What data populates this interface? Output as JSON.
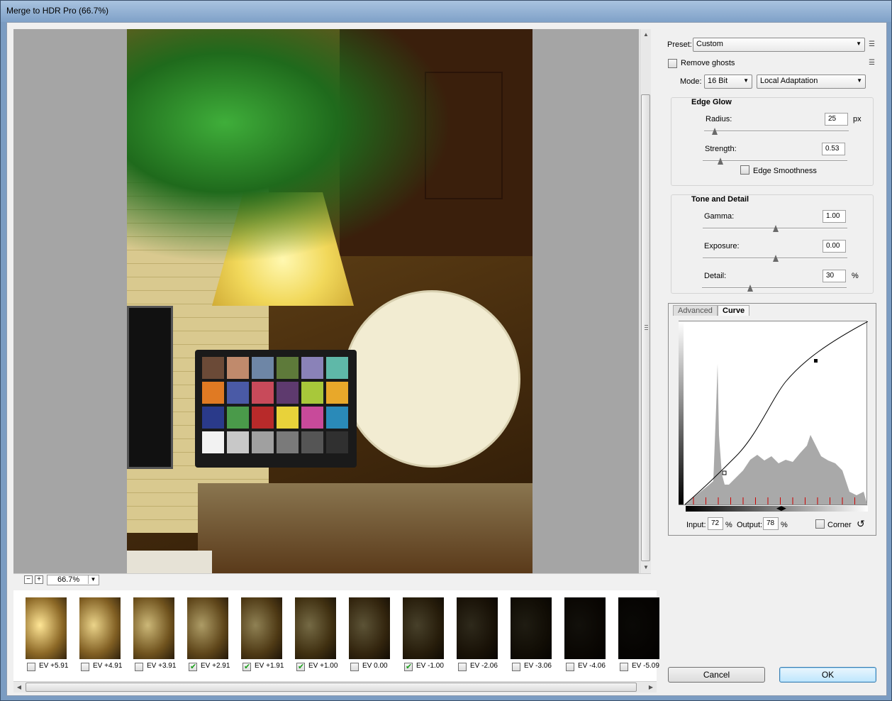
{
  "window": {
    "title": "Merge to HDR Pro (66.7%)"
  },
  "zoom": {
    "value": "66.7%",
    "minus": "−",
    "plus": "+"
  },
  "preset": {
    "label": "Preset:",
    "value": "Custom"
  },
  "remove_ghosts": {
    "label": "Remove ghosts",
    "checked": false
  },
  "mode": {
    "label": "Mode:",
    "bit_depth": "16 Bit",
    "method": "Local Adaptation"
  },
  "edge_glow": {
    "title": "Edge Glow",
    "radius": {
      "label": "Radius:",
      "value": "25",
      "unit": "px",
      "fraction": 0.07
    },
    "strength": {
      "label": "Strength:",
      "value": "0.53",
      "fraction": 0.12
    },
    "edge_smoothness": {
      "label": "Edge Smoothness",
      "checked": false
    }
  },
  "tone_detail": {
    "title": "Tone and Detail",
    "gamma": {
      "label": "Gamma:",
      "value": "1.00",
      "fraction": 0.5
    },
    "exposure": {
      "label": "Exposure:",
      "value": "0.00",
      "fraction": 0.5
    },
    "detail": {
      "label": "Detail:",
      "value": "30",
      "unit": "%",
      "fraction": 0.33
    }
  },
  "tabs": {
    "advanced": "Advanced",
    "curve": "Curve"
  },
  "curve": {
    "input_label": "Input:",
    "input_value": "72",
    "input_unit": "%",
    "output_label": "Output:",
    "output_value": "78",
    "output_unit": "%",
    "corner_label": "Corner",
    "corner_checked": false
  },
  "buttons": {
    "cancel": "Cancel",
    "ok": "OK"
  },
  "exposures": [
    {
      "label": "EV +5.91",
      "checked": false,
      "brightness": 1.0
    },
    {
      "label": "EV +4.91",
      "checked": false,
      "brightness": 0.92
    },
    {
      "label": "EV +3.91",
      "checked": false,
      "brightness": 0.8
    },
    {
      "label": "EV +2.91",
      "checked": true,
      "brightness": 0.68
    },
    {
      "label": "EV +1.91",
      "checked": true,
      "brightness": 0.56
    },
    {
      "label": "EV +1.00",
      "checked": true,
      "brightness": 0.46
    },
    {
      "label": "EV 0.00",
      "checked": false,
      "brightness": 0.36
    },
    {
      "label": "EV -1.00",
      "checked": true,
      "brightness": 0.28
    },
    {
      "label": "EV -2.06",
      "checked": false,
      "brightness": 0.18
    },
    {
      "label": "EV -3.06",
      "checked": false,
      "brightness": 0.12
    },
    {
      "label": "EV -4.06",
      "checked": false,
      "brightness": 0.07
    },
    {
      "label": "EV -5.09",
      "checked": false,
      "brightness": 0.04
    }
  ],
  "colors": {
    "accent_default_button": "#3c7fb1",
    "checkmark": "#1b9d1b"
  }
}
